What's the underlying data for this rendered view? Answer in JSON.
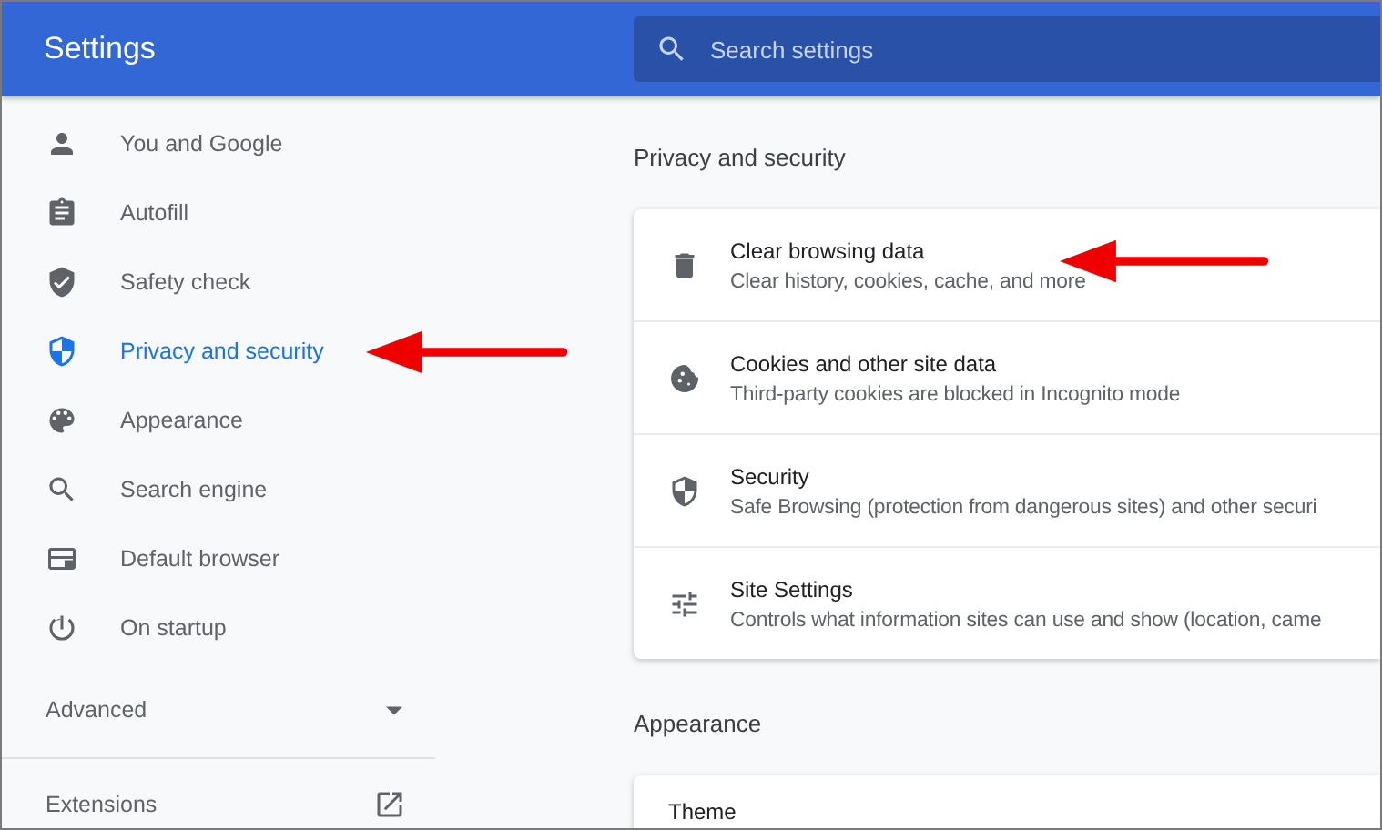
{
  "header": {
    "title": "Settings",
    "search": {
      "placeholder": "Search settings"
    }
  },
  "sidebar": {
    "items": [
      {
        "label": "You and Google",
        "selected": false
      },
      {
        "label": "Autofill",
        "selected": false
      },
      {
        "label": "Safety check",
        "selected": false
      },
      {
        "label": "Privacy and security",
        "selected": true
      },
      {
        "label": "Appearance",
        "selected": false
      },
      {
        "label": "Search engine",
        "selected": false
      },
      {
        "label": "Default browser",
        "selected": false
      },
      {
        "label": "On startup",
        "selected": false
      }
    ],
    "advanced": {
      "label": "Advanced",
      "expanded": false
    },
    "extensions": {
      "label": "Extensions"
    }
  },
  "sections": [
    {
      "title": "Privacy and security",
      "rows": [
        {
          "title": "Clear browsing data",
          "subtitle": "Clear history, cookies, cache, and more"
        },
        {
          "title": "Cookies and other site data",
          "subtitle": "Third-party cookies are blocked in Incognito mode"
        },
        {
          "title": "Security",
          "subtitle": "Safe Browsing (protection from dangerous sites) and other securi"
        },
        {
          "title": "Site Settings",
          "subtitle": "Controls what information sites can use and show (location, came"
        }
      ]
    },
    {
      "title": "Appearance",
      "rows": [
        {
          "title": "Theme"
        }
      ]
    }
  ]
}
